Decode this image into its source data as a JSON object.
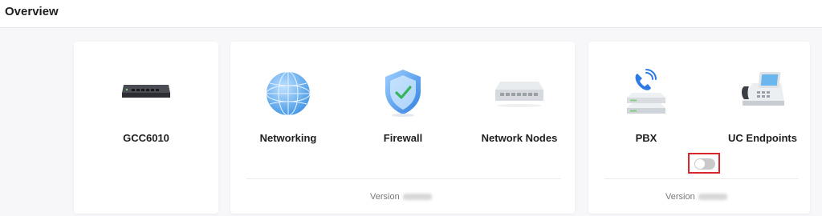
{
  "header": {
    "title": "Overview"
  },
  "device": {
    "name": "GCC6010"
  },
  "network": {
    "items": [
      {
        "label": "Networking",
        "icon": "globe-icon"
      },
      {
        "label": "Firewall",
        "icon": "shield-check-icon"
      },
      {
        "label": "Network Nodes",
        "icon": "switch-icon"
      }
    ],
    "version_label": "Version"
  },
  "uc": {
    "items": [
      {
        "label": "PBX",
        "icon": "pbx-server-icon"
      },
      {
        "label": "UC Endpoints",
        "icon": "desk-phone-icon"
      }
    ],
    "toggle_on": false,
    "version_label": "Version"
  },
  "colors": {
    "accent_highlight": "#d9262c",
    "toggle_off": "#c9c9c9",
    "globe_blue": "#5aa9ec"
  }
}
